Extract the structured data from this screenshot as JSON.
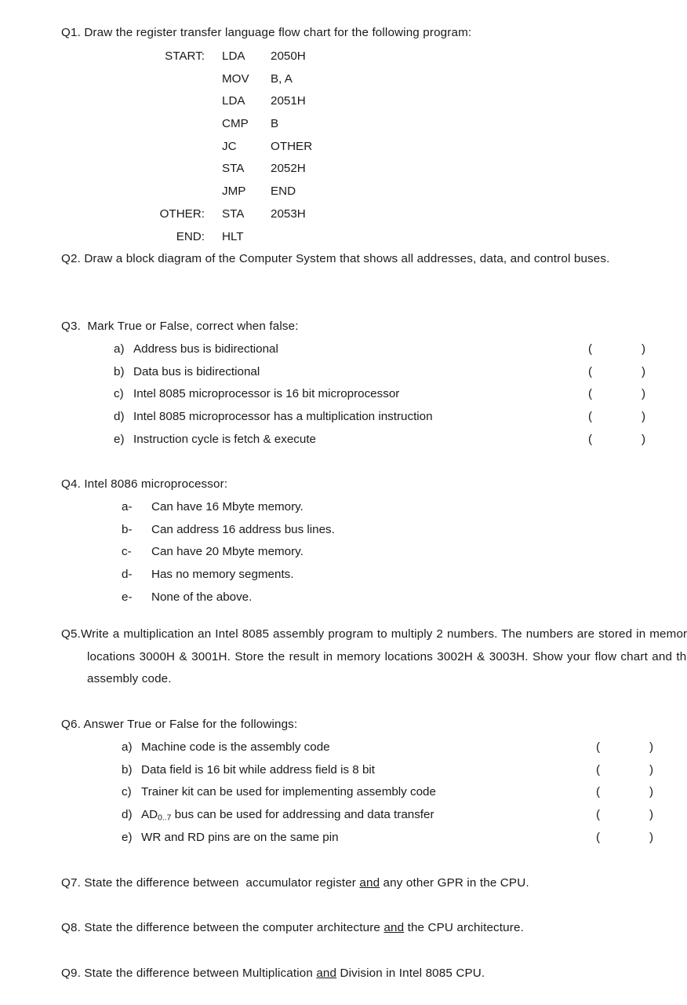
{
  "document": {
    "type": "exam-question-sheet",
    "background_color": "#ffffff",
    "text_color": "#1a1a1a"
  },
  "q1": {
    "label": "Q1.",
    "prompt": "Draw the register transfer language flow chart for the following program:",
    "program": [
      {
        "label": "START:",
        "mnemonic": "LDA",
        "operand": "2050H"
      },
      {
        "label": "",
        "mnemonic": "MOV",
        "operand": "B, A"
      },
      {
        "label": "",
        "mnemonic": "LDA",
        "operand": "2051H"
      },
      {
        "label": "",
        "mnemonic": "CMP",
        "operand": "B"
      },
      {
        "label": "",
        "mnemonic": "JC",
        "operand": "OTHER"
      },
      {
        "label": "",
        "mnemonic": "STA",
        "operand": "2052H"
      },
      {
        "label": "",
        "mnemonic": "JMP",
        "operand": "END"
      },
      {
        "label": "OTHER:",
        "mnemonic": "STA",
        "operand": "2053H"
      },
      {
        "label": "END:",
        "mnemonic": "HLT",
        "operand": ""
      }
    ]
  },
  "q2": {
    "label": "Q2.",
    "text": "Draw a block diagram of the Computer System that shows all addresses, data, and control buses."
  },
  "q3": {
    "label": "Q3.",
    "prompt": "Mark True or False, correct when false:",
    "paren_open": "(",
    "paren_close": ")",
    "items": [
      {
        "marker": "a)",
        "text": "Address bus is bidirectional"
      },
      {
        "marker": "b)",
        "text": "Data bus is bidirectional"
      },
      {
        "marker": "c)",
        "text": "Intel 8085 microprocessor is 16 bit microprocessor"
      },
      {
        "marker": "d)",
        "text": "Intel 8085 microprocessor has a multiplication instruction"
      },
      {
        "marker": "e)",
        "text": "Instruction cycle is fetch & execute"
      }
    ]
  },
  "q4": {
    "label": "Q4.",
    "prompt": "Intel 8086 microprocessor:",
    "items": [
      {
        "marker": "a-",
        "text": "Can have 16 Mbyte memory."
      },
      {
        "marker": "b-",
        "text": "Can address 16 address bus lines."
      },
      {
        "marker": "c-",
        "text": "Can have 20 Mbyte memory."
      },
      {
        "marker": "d-",
        "text": "Has no memory segments."
      },
      {
        "marker": "e-",
        "text": "None of the above."
      }
    ]
  },
  "q5": {
    "label": "Q5.",
    "text": "Write a multiplication an Intel 8085 assembly program to multiply 2 numbers. The numbers are stored in memory locations 3000H & 3001H. Store the result in memory locations 3002H & 3003H. Show your flow chart and the assembly code."
  },
  "q6": {
    "label": "Q6.",
    "prompt": "Answer True or False for the followings:",
    "paren_open": "(",
    "paren_close": ")",
    "items": [
      {
        "marker": "a)",
        "text": "Machine code is the assembly code"
      },
      {
        "marker": "b)",
        "text": "Data field is 16 bit while address field is 8 bit"
      },
      {
        "marker": "c)",
        "text": "Trainer kit can be used for implementing assembly code"
      },
      {
        "marker": "d)",
        "text_pre": "AD",
        "subscript": "0..7",
        "text_post": " bus can be used for addressing and data transfer"
      },
      {
        "marker": "e)",
        "text": "WR and RD pins are on the same pin"
      }
    ]
  },
  "q7": {
    "label": "Q7.",
    "text_pre": "State the difference between  accumulator register ",
    "underlined": "and",
    "text_post": " any other GPR in the CPU."
  },
  "q8": {
    "label": "Q8.",
    "text_pre": "State the difference between the computer architecture ",
    "underlined": "and",
    "text_post": " the CPU architecture."
  },
  "q9": {
    "label": "Q9.",
    "text_pre": "State the difference between Multiplication ",
    "underlined": "and",
    "text_post": " Division in Intel 8085 CPU."
  }
}
